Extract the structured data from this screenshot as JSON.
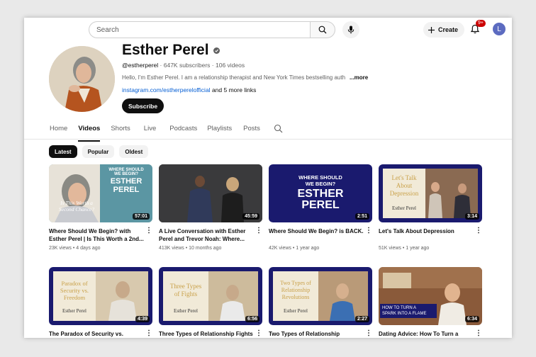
{
  "topbar": {
    "search_placeholder": "Search",
    "create_label": "Create",
    "notif_count": "9+",
    "user_initial": "L"
  },
  "channel": {
    "name": "Esther Perel",
    "handle": "@estherperel",
    "subscribers": "647K subscribers",
    "videos": "106 videos",
    "description": "Hello, I'm Esther Perel. I am a relationship therapist and New York Times bestselling auth",
    "more_label": "...more",
    "link": "instagram.com/estherperelofficial",
    "more_links": "and 5 more links",
    "subscribe_label": "Subscribe"
  },
  "tabs": [
    "Home",
    "Videos",
    "Shorts",
    "Live",
    "Podcasts",
    "Playlists",
    "Posts"
  ],
  "active_tab": "Videos",
  "chips": [
    "Latest",
    "Popular",
    "Oldest"
  ],
  "videos": [
    {
      "title": "Where Should We Begin? with Esther Perel | Is This Worth a 2nd...",
      "views": "23K views",
      "age": "4 days ago",
      "duration": "57:01",
      "thumb_text": [
        "WHERE SHOULD",
        "WE BEGIN?",
        "ESTHER",
        "PEREL",
        "Is This Worth a",
        "Second Chance?"
      ]
    },
    {
      "title": "A Live Conversation with Esther Perel and Trevor Noah: Where...",
      "views": "413K views",
      "age": "10 months ago",
      "duration": "45:59",
      "thumb_text": []
    },
    {
      "title": "Where Should We Begin? is BACK.",
      "views": "42K views",
      "age": "1 year ago",
      "duration": "2:51",
      "thumb_text": [
        "WHERE SHOULD",
        "WE BEGIN?",
        "ESTHER",
        "PEREL"
      ]
    },
    {
      "title": "Let's Talk About Depression",
      "views": "51K views",
      "age": "1 year ago",
      "duration": "3:14",
      "thumb_text": [
        "Let's Talk",
        "About",
        "Depression",
        "Esther Perel"
      ]
    },
    {
      "title": "The Paradox of Security vs.",
      "views": "",
      "age": "",
      "duration": "4:39",
      "thumb_text": [
        "Paradox of",
        "Security vs.",
        "Freedom",
        "Esther Perel"
      ]
    },
    {
      "title": "Three Types of Relationship Fights",
      "views": "",
      "age": "",
      "duration": "6:56",
      "thumb_text": [
        "Three Types",
        "of Fights",
        "Esther Perel"
      ]
    },
    {
      "title": "Two Types of Relationship",
      "views": "",
      "age": "",
      "duration": "2:27",
      "thumb_text": [
        "Two Types of",
        "Relationship",
        "Revolutions",
        "Esther Perel"
      ]
    },
    {
      "title": "Dating Advice: How To Turn a Spark",
      "views": "",
      "age": "",
      "duration": "6:34",
      "thumb_text": [
        "HOW TO TURN A",
        "SPARK INTO A FLAME"
      ]
    }
  ],
  "colors": {
    "accent_link": "#065fd4",
    "navy": "#1a1a6e",
    "cream": "#f1ead8",
    "gold": "#c9a14a"
  }
}
